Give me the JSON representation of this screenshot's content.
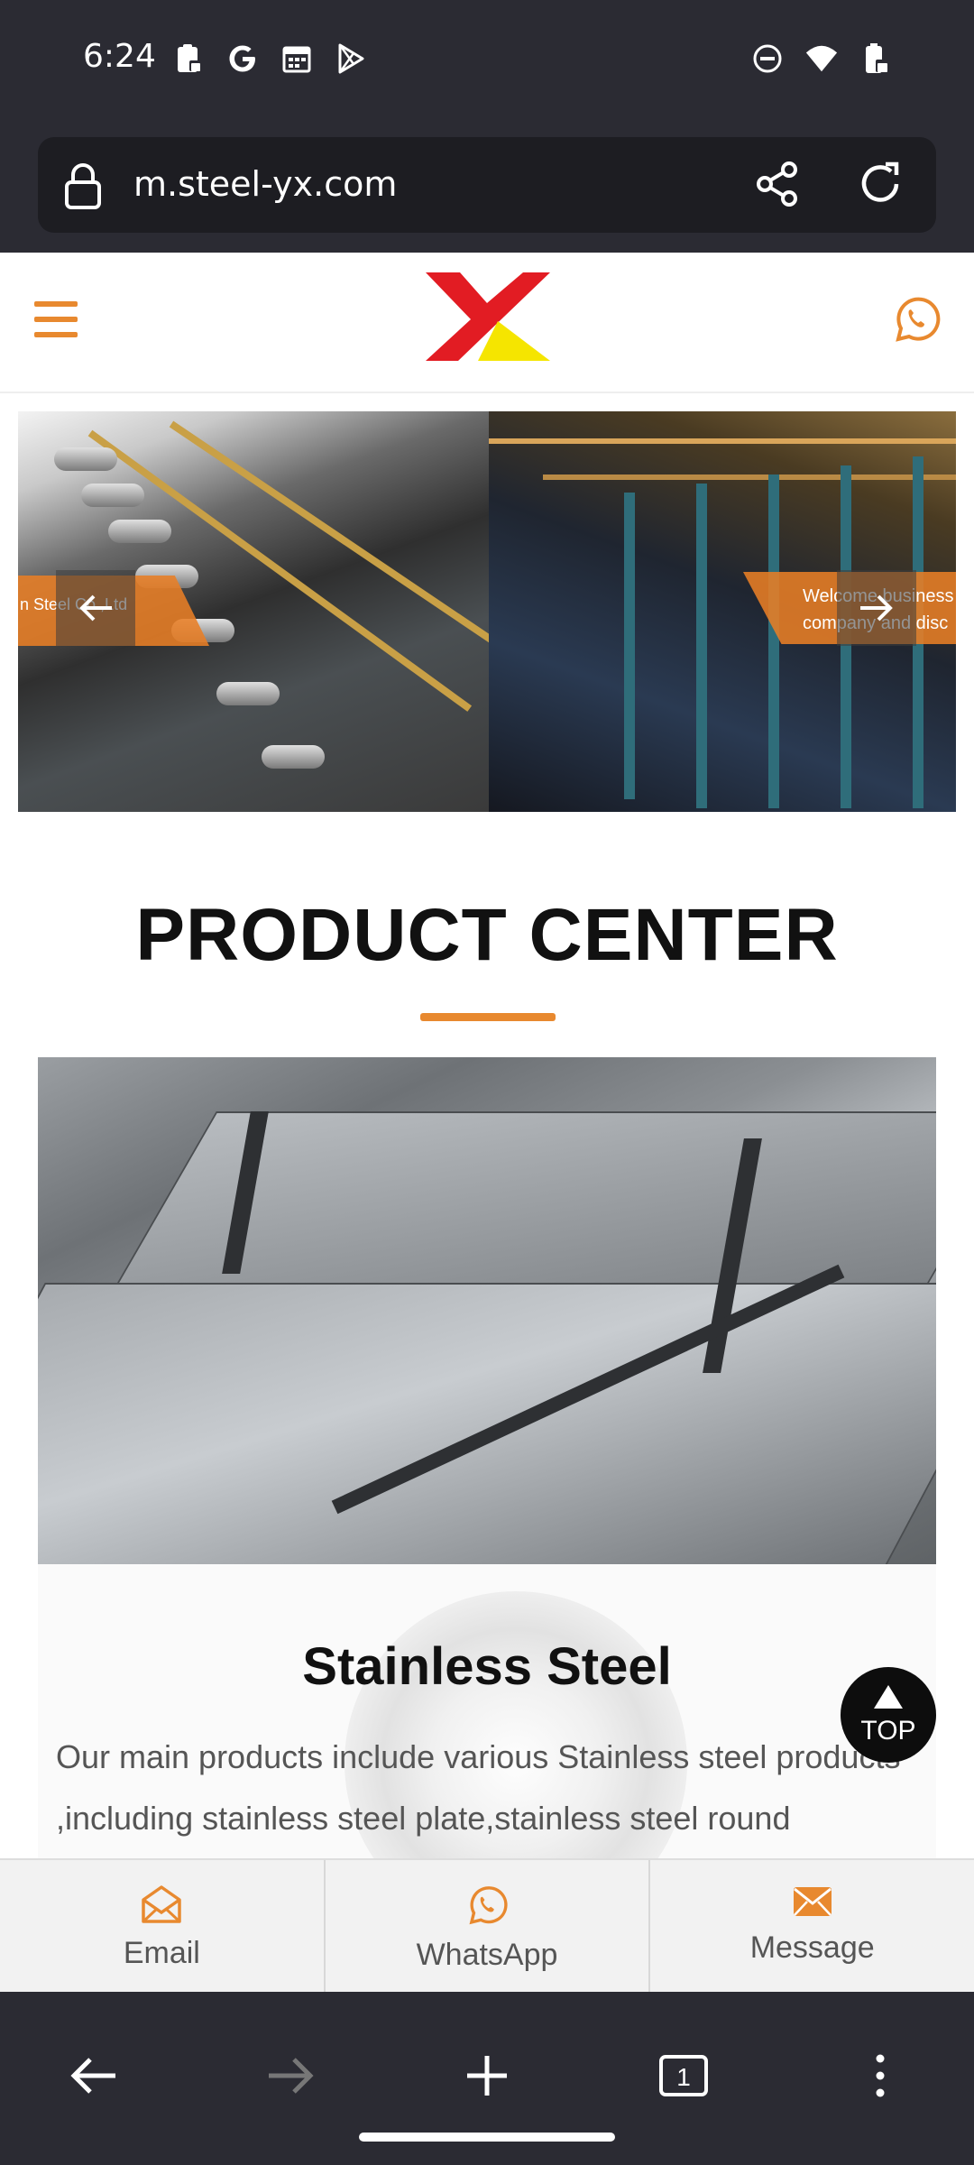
{
  "status_bar": {
    "time": "6:24",
    "left_icons": [
      "clipboard-lock-icon",
      "google-icon",
      "calendar-icon",
      "play-store-icon"
    ],
    "right_icons": [
      "do-not-disturb-icon",
      "wifi-icon",
      "battery-lock-icon"
    ]
  },
  "browser": {
    "url": "m.steel-yx.com",
    "tab_count": "1"
  },
  "header": {
    "brand_colors": {
      "accent": "#e8892f",
      "logo_red": "#e21c23",
      "logo_yellow": "#f5e500"
    }
  },
  "slider": {
    "left_caption": "n Steel Co.,Ltd",
    "right_caption_line1": "Welcome business",
    "right_caption_line2": "company and disc"
  },
  "product_center": {
    "title": "PRODUCT CENTER",
    "product_title": "Stainless Steel",
    "product_description": "Our main products include various Stainless steel products ,including stainless steel plate,stainless steel round"
  },
  "top_button": {
    "label": "TOP"
  },
  "contact_bar": {
    "email_label": "Email",
    "whatsapp_label": "WhatsApp",
    "message_label": "Message"
  }
}
